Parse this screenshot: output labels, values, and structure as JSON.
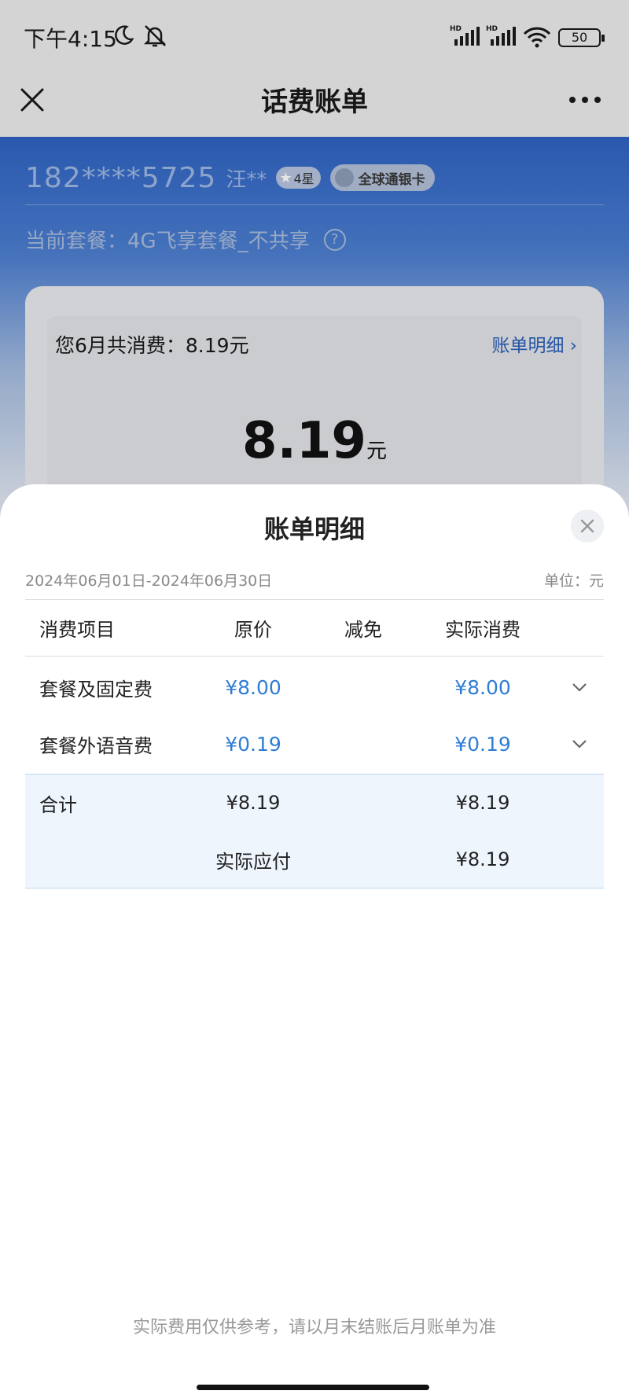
{
  "status_bar": {
    "time": "下午4:15",
    "battery": "50"
  },
  "nav": {
    "title": "话费账单"
  },
  "background": {
    "phone": "182****5725",
    "name": "汪**",
    "star_level": "4星",
    "card_type": "全球通银卡",
    "plan": "当前套餐：4G飞享套餐_不共享",
    "help_symbol": "?",
    "consume_summary": "您6月共消费：8.19元",
    "detail_link": "账单明细",
    "amount": "8.19",
    "amount_unit": "元"
  },
  "sheet": {
    "title": "账单明细",
    "date_range": "2024年06月01日-2024年06月30日",
    "unit": "单位：元",
    "columns": [
      "消费项目",
      "原价",
      "减免",
      "实际消费"
    ],
    "rows": [
      {
        "item": "套餐及固定费",
        "original": "¥8.00",
        "reduction": "",
        "actual": "¥8.00"
      },
      {
        "item": "套餐外语音费",
        "original": "¥0.19",
        "reduction": "",
        "actual": "¥0.19"
      }
    ],
    "total": {
      "label": "合计",
      "original": "¥8.19",
      "actual": "¥8.19"
    },
    "payable": {
      "label": "实际应付",
      "value": "¥8.19"
    },
    "footer_note": "实际费用仅供参考，请以月末结账后月账单为准"
  },
  "colors": {
    "accent_blue": "#2f7dd4",
    "header_blue": "#2f63c3",
    "total_bg": "#eef5fd"
  },
  "icons": [
    "moon-icon",
    "bell-off-icon",
    "signal-icon",
    "wifi-icon",
    "close-icon",
    "more-icon",
    "help-icon",
    "chevron-right-icon",
    "chevron-down-icon"
  ]
}
